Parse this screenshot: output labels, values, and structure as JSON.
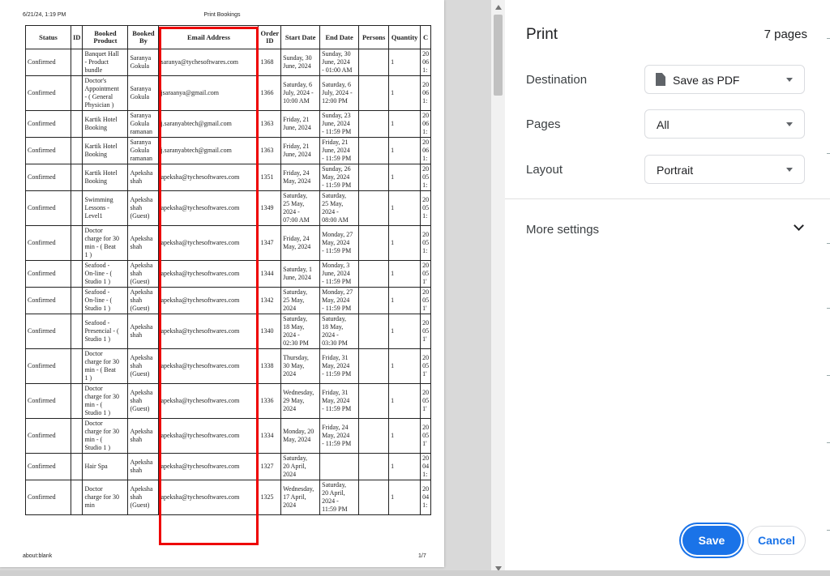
{
  "page": {
    "header_date": "6/21/24, 1:19 PM",
    "header_title": "Print Bookings",
    "footer_url": "about:blank",
    "footer_page": "1/7"
  },
  "table": {
    "columns": [
      "Status",
      "ID",
      "Booked\nProduct",
      "Booked\nBy",
      "Email Address",
      "Order\nID",
      "Start Date",
      "End Date",
      "Persons",
      "Quantity",
      "C"
    ],
    "rows": [
      [
        "Confirmed",
        "",
        "Banquet Hall\n- Product\nbundle",
        "Saranya\nGokula",
        "saranya@tychesoftwares.com",
        "1368",
        "Sunday, 30\nJune, 2024",
        "Sunday, 30\nJune, 2024\n- 01:00 AM",
        "",
        "1",
        "20\n06\n1:"
      ],
      [
        "Confirmed",
        "",
        "Doctor's\nAppointment\n- ( General\nPhysician )",
        "Saranya\nGokula",
        "jsaraanya@gmail.com",
        "1366",
        "Saturday, 6\nJuly, 2024 -\n10:00 AM",
        "Saturday, 6\nJuly, 2024 -\n12:00 PM",
        "",
        "1",
        "20\n06\n1:"
      ],
      [
        "Confirmed",
        "",
        "Kartik Hotel\nBooking",
        "Saranya\nGokula\nramanan",
        "j.saranyabtech@gmail.com",
        "1363",
        "Friday, 21\nJune, 2024",
        "Sunday, 23\nJune, 2024\n- 11:59 PM",
        "",
        "1",
        "20\n06\n1:"
      ],
      [
        "Confirmed",
        "",
        "Kartik Hotel\nBooking",
        "Saranya\nGokula\nramanan",
        "j.saranyabtech@gmail.com",
        "1363",
        "Friday, 21\nJune, 2024",
        "Friday, 21\nJune, 2024\n- 11:59 PM",
        "",
        "1",
        "20\n06\n1:"
      ],
      [
        "Confirmed",
        "",
        "Kartik Hotel\nBooking",
        "Apeksha\nshah",
        "apeksha@tychesoftwares.com",
        "1351",
        "Friday, 24\nMay, 2024",
        "Sunday, 26\nMay, 2024\n- 11:59 PM",
        "",
        "1",
        "20\n05\n1:"
      ],
      [
        "Confirmed",
        "",
        "Swimming\nLessons -\nLevel1",
        "Apeksha\nshah\n(Guest)",
        "apeksha@tychesoftwares.com",
        "1349",
        "Saturday,\n25 May,\n2024 -\n07:00 AM",
        "Saturday,\n25 May,\n2024 -\n08:00 AM",
        "",
        "1",
        "20\n05\n1:"
      ],
      [
        "Confirmed",
        "",
        "Doctor\ncharge for 30\nmin - ( Beat\n1 )",
        "Apeksha\nshah",
        "apeksha@tychesoftwares.com",
        "1347",
        "Friday, 24\nMay, 2024",
        "Monday, 27\nMay, 2024\n- 11:59 PM",
        "",
        "1",
        "20\n05\n1:"
      ],
      [
        "Confirmed",
        "",
        "Seafood -\nOn-line - (\nStudio 1 )",
        "Apeksha\nshah\n(Guest)",
        "apeksha@tychesoftwares.com",
        "1344",
        "Saturday, 1\nJune, 2024",
        "Monday, 3\nJune, 2024\n- 11:59 PM",
        "",
        "1",
        "20\n05\n1'"
      ],
      [
        "Confirmed",
        "",
        "Seafood -\nOn-line - (\nStudio 1 )",
        "Apeksha\nshah\n(Guest)",
        "apeksha@tychesoftwares.com",
        "1342",
        "Saturday,\n25 May,\n2024",
        "Monday, 27\nMay, 2024\n- 11:59 PM",
        "",
        "1",
        "20\n05\n1'"
      ],
      [
        "Confirmed",
        "",
        "Seafood -\nPresencial - (\nStudio 1 )",
        "Apeksha\nshah",
        "apeksha@tychesoftwares.com",
        "1340",
        "Saturday,\n18 May,\n2024 -\n02:30 PM",
        "Saturday,\n18 May,\n2024 -\n03:30 PM",
        "",
        "1",
        "20\n05\n1'"
      ],
      [
        "Confirmed",
        "",
        "Doctor\ncharge for 30\nmin - ( Beat\n1 )",
        "Apeksha\nshah\n(Guest)",
        "apeksha@tychesoftwares.com",
        "1338",
        "Thursday,\n30 May,\n2024",
        "Friday, 31\nMay, 2024\n- 11:59 PM",
        "",
        "1",
        "20\n05\n1'"
      ],
      [
        "Confirmed",
        "",
        "Doctor\ncharge for 30\nmin - (\nStudio 1 )",
        "Apeksha\nshah\n(Guest)",
        "apeksha@tychesoftwares.com",
        "1336",
        "Wednesday,\n29 May,\n2024",
        "Friday, 31\nMay, 2024\n- 11:59 PM",
        "",
        "1",
        "20\n05\n1'"
      ],
      [
        "Confirmed",
        "",
        "Doctor\ncharge for 30\nmin - (\nStudio 1 )",
        "Apeksha\nshah",
        "apeksha@tychesoftwares.com",
        "1334",
        "Monday, 20\nMay, 2024",
        "Friday, 24\nMay, 2024\n- 11:59 PM",
        "",
        "1",
        "20\n05\n1'"
      ],
      [
        "Confirmed",
        "",
        "Hair Spa",
        "Apeksha\nshah",
        "apeksha@tychesoftwares.com",
        "1327",
        "Saturday,\n20 April,\n2024",
        "",
        "",
        "1",
        "20\n04\n1:"
      ],
      [
        "Confirmed",
        "",
        "Doctor\ncharge for 30\nmin",
        "Apeksha\nshah\n(Guest)",
        "apeksha@tychesoftwares.com",
        "1325",
        "Wednesday,\n17 April,\n2024",
        "Saturday,\n20 April,\n2024 -\n11:59 PM",
        "",
        "1",
        "20\n04\n1:"
      ]
    ]
  },
  "print_panel": {
    "title": "Print",
    "page_count": "7 pages",
    "destination_label": "Destination",
    "destination_value": "Save as PDF",
    "pages_label": "Pages",
    "pages_value": "All",
    "layout_label": "Layout",
    "layout_value": "Portrait",
    "more_settings_label": "More settings",
    "save_label": "Save",
    "cancel_label": "Cancel"
  },
  "colors": {
    "accent": "#1a73e8",
    "highlight": "#e00000"
  },
  "icons": [
    "document-icon",
    "chevron-down-icon",
    "expand-chevron-icon"
  ]
}
